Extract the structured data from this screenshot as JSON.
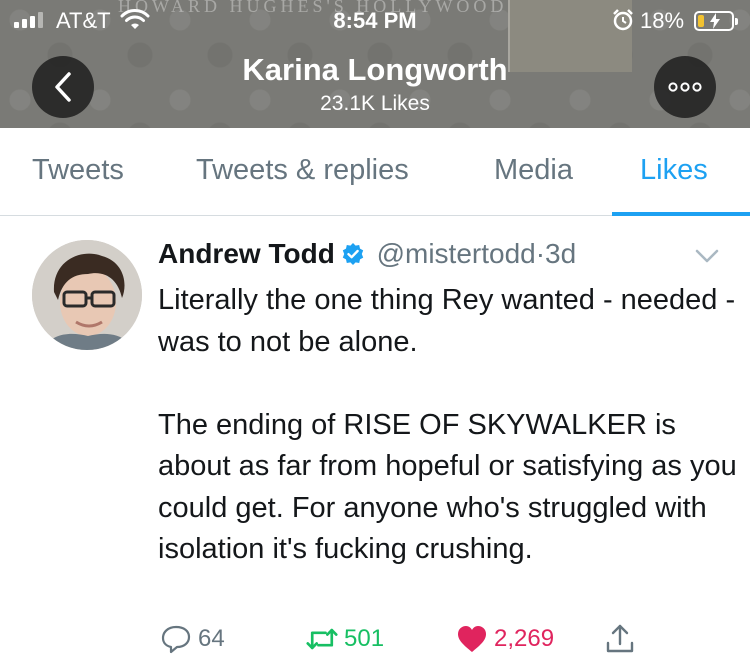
{
  "status_bar": {
    "carrier": "AT&T",
    "time": "8:54 PM",
    "battery_percent": "18%",
    "battery_level": 0.18,
    "signal_bars_active": 3
  },
  "header": {
    "banner_text": "HOWARD HUGHES'S HOLLYWOOD",
    "title": "Karina Longworth",
    "subtitle": "23.1K Likes"
  },
  "tabs": [
    {
      "label": "Tweets",
      "active": false
    },
    {
      "label": "Tweets & replies",
      "active": false
    },
    {
      "label": "Media",
      "active": false
    },
    {
      "label": "Likes",
      "active": true
    }
  ],
  "tweet": {
    "author_name": "Andrew Todd",
    "handle": "@mistertodd",
    "separator": "·",
    "age": "3d",
    "text": "Literally the one thing Rey wanted - needed - was to not be alone.\n\nThe ending of RISE OF SKYWALKER is about as far from hopeful or satisfying as you could get. For anyone who's struggled with isolation it's fucking crushing.",
    "actions": {
      "replies": "64",
      "retweets": "501",
      "likes": "2,269"
    }
  },
  "colors": {
    "accent": "#1da1f2",
    "retweet": "#17bf63",
    "like": "#e0245e",
    "muted": "#66757f"
  }
}
